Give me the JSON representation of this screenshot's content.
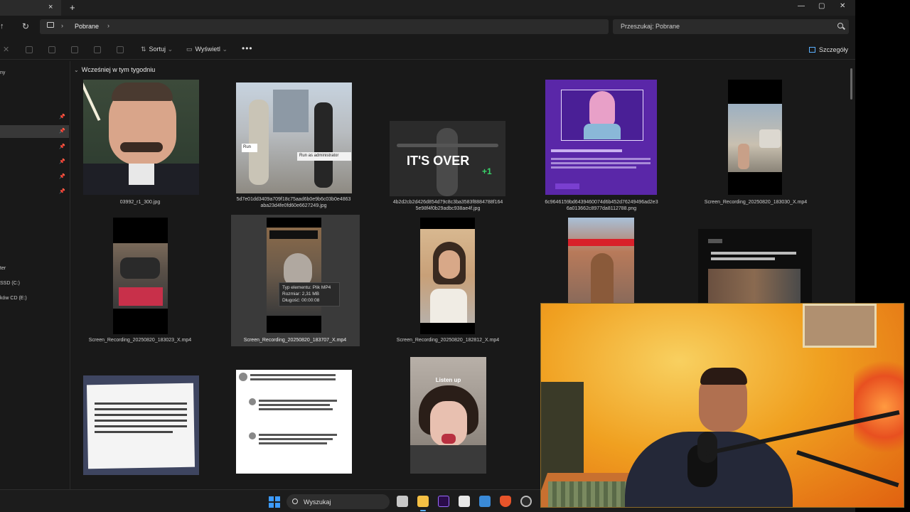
{
  "window": {
    "tab_close": "×",
    "new_tab": "+",
    "minimize": "—",
    "maximize": "▢",
    "close": "✕"
  },
  "address": {
    "separator": "›",
    "current_folder": "Pobrane"
  },
  "search": {
    "placeholder": "Przeszukaj: Pobrane"
  },
  "toolbar": {
    "sort_label": "Sortuj",
    "view_label": "Wyświetl",
    "more_label": "•••",
    "details_label": "Szczegóły"
  },
  "sidebar": {
    "items": [
      {
        "label": "ny"
      },
      {
        "label": "ter"
      },
      {
        "label": "SSD (C:)"
      },
      {
        "label": "ków CD (E:)"
      }
    ]
  },
  "group": {
    "label": "Wcześniej w tym tygodniu"
  },
  "files": [
    {
      "name": "03992_r1_300.jpg"
    },
    {
      "name": "5d7e01dd3409a709f18c75aad6b0e9b6c03b0e4863 aba23d4fe0fd60e6627249.jpg"
    },
    {
      "name": "4b2d2cb2d426d854d79c8c3ba3583f8884788f164 5e98f4f0b29adbc938ae4f.jpg"
    },
    {
      "name": "6c9646159bd6439460074d6b452d76249496ad2e3 6a013662c8977da8112788.png"
    },
    {
      "name": "Screen_Recording_20250820_183030_X.mp4"
    },
    {
      "name": "Screen_Recording_20250820_183023_X.mp4"
    },
    {
      "name": "Screen_Recording_20250820_183707_X.mp4"
    },
    {
      "name": "Screen_Recording_20250820_182812_X.mp4"
    },
    {
      "name": ""
    },
    {
      "name": ""
    },
    {
      "name": ""
    },
    {
      "name": ""
    },
    {
      "name": ""
    }
  ],
  "thumb_text": {
    "meme_caption": "IT'S OVER",
    "meme_plus": "+1",
    "run_label": "Run",
    "run_admin": "Run as administrator",
    "listen_up": "Listen up"
  },
  "tooltip": {
    "line1": "Typ elementu: Plik MP4",
    "line2": "Rozmiar: 2,31 MB",
    "line3": "Długość: 00:00:08"
  },
  "taskbar": {
    "search_label": "Wyszukaj"
  },
  "colors": {
    "accent": "#3d9bff",
    "window_bg": "#191919",
    "webcam_wall": "#f0a020"
  }
}
